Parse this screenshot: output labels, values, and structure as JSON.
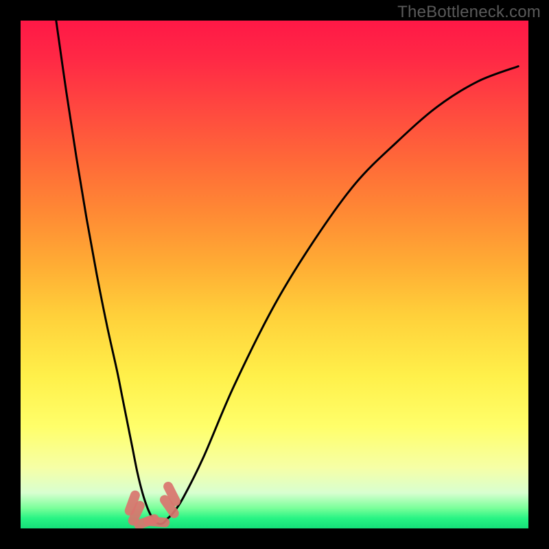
{
  "watermark": "TheBottleneck.com",
  "chart_data": {
    "type": "line",
    "title": "",
    "xlabel": "",
    "ylabel": "",
    "xlim": [
      0,
      100
    ],
    "ylim": [
      0,
      100
    ],
    "grid": false,
    "series": [
      {
        "name": "curve",
        "x": [
          7,
          9,
          11,
          13,
          15,
          17,
          19,
          20,
          21,
          22,
          23,
          24,
          25,
          26,
          27,
          28,
          29,
          30,
          32,
          36,
          42,
          50,
          58,
          66,
          74,
          82,
          90,
          98
        ],
        "values": [
          100,
          86,
          73,
          61,
          50,
          40,
          31,
          26,
          21,
          16,
          11,
          7,
          4,
          2,
          1,
          1,
          2,
          3,
          6,
          14,
          28,
          44,
          57,
          68,
          76,
          83,
          88,
          91
        ]
      }
    ],
    "markers": [
      {
        "x": 22.0,
        "y": 5.0,
        "angle_deg": 70
      },
      {
        "x": 22.8,
        "y": 3.0,
        "angle_deg": 65
      },
      {
        "x": 24.8,
        "y": 1.3,
        "angle_deg": 20
      },
      {
        "x": 26.8,
        "y": 1.3,
        "angle_deg": -5
      },
      {
        "x": 29.3,
        "y": 4.3,
        "angle_deg": -55
      },
      {
        "x": 29.8,
        "y": 6.8,
        "angle_deg": -63
      }
    ],
    "colors": {
      "curve": "#000000",
      "marker_fill": "#d9746e",
      "gradient_top": "#ff1846",
      "gradient_bottom": "#15e079",
      "frame": "#000000"
    }
  }
}
